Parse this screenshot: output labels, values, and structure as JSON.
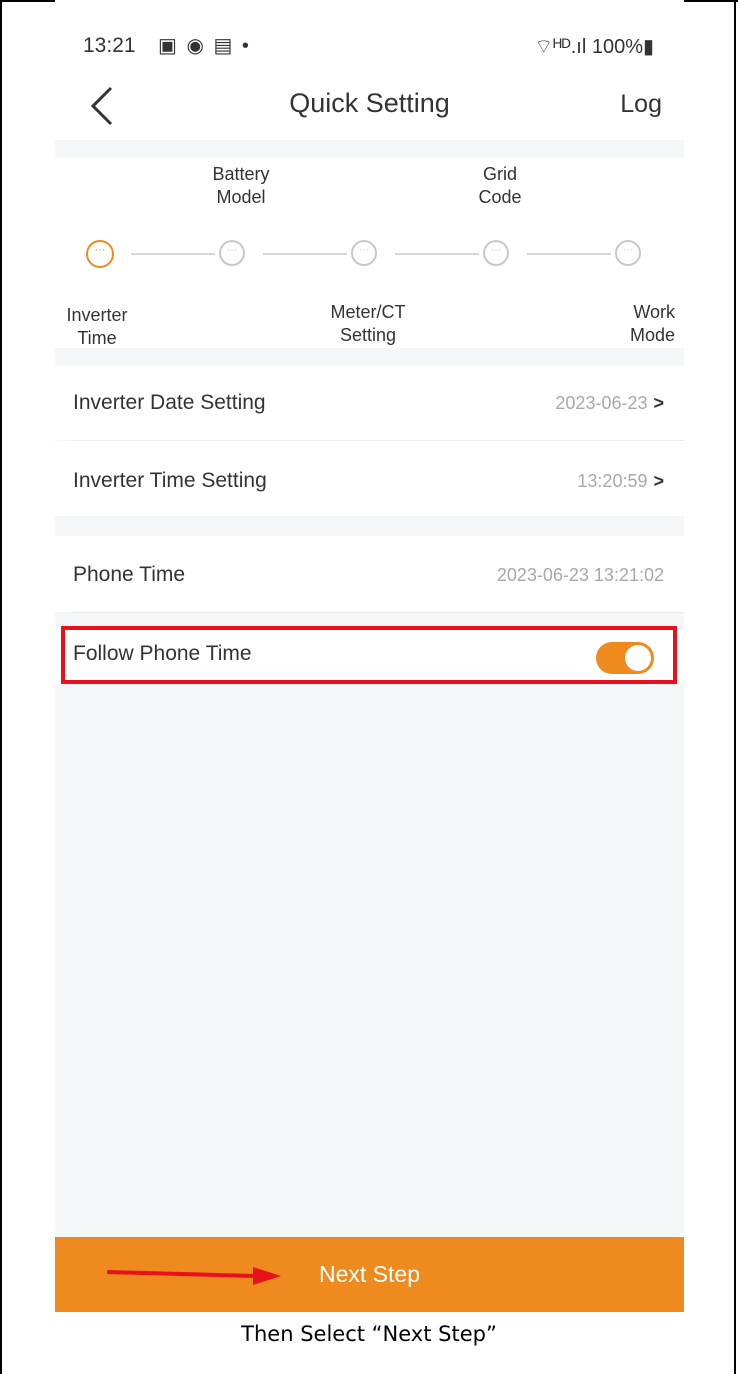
{
  "status_bar": {
    "time": "13:21",
    "notification_icons": "▣ ◉ ▤ •",
    "signal_battery": "⌔ᴴᴰ.ıl 100%▮"
  },
  "nav": {
    "title": "Quick Setting",
    "log_label": "Log"
  },
  "stepper": {
    "steps": [
      {
        "label": "Inverter\nTime",
        "state": "active",
        "glyph": "···"
      },
      {
        "label": "Battery\nModel",
        "state": "pending",
        "glyph": "···"
      },
      {
        "label": "Meter/CT\nSetting",
        "state": "pending",
        "glyph": "···"
      },
      {
        "label": "Grid\nCode",
        "state": "pending",
        "glyph": "···"
      },
      {
        "label": "Work\nMode",
        "state": "pending",
        "glyph": "···"
      }
    ]
  },
  "settings": {
    "date_label": "Inverter Date Setting",
    "date_value": "2023-06-23",
    "time_label": "Inverter Time Setting",
    "time_value": "13:20:59",
    "phone_time_label": "Phone Time",
    "phone_time_value": "2023-06-23 13:21:02",
    "follow_label": "Follow Phone Time",
    "follow_enabled": true
  },
  "footer": {
    "next_label": "Next Step"
  },
  "caption": "Then Select “Next Step”",
  "colors": {
    "accent": "#ee8a1e",
    "highlight": "#e8101a"
  }
}
